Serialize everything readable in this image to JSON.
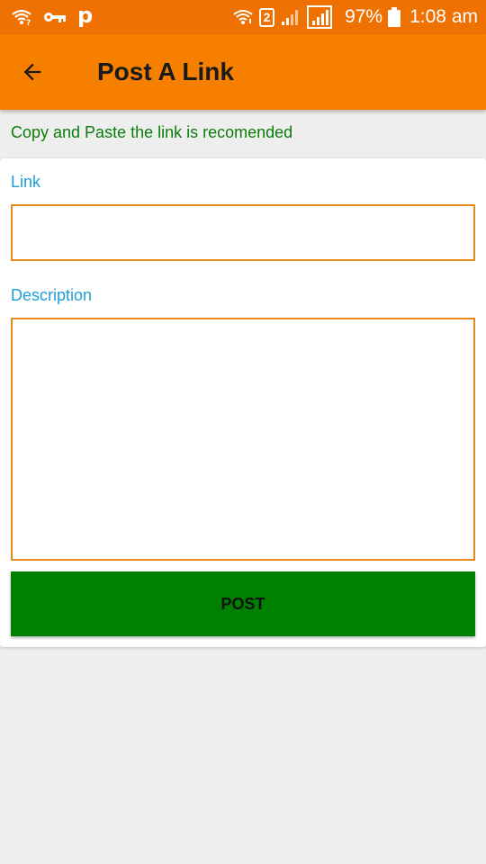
{
  "status_bar": {
    "left_icons": [
      "wifi-question-icon",
      "vpn-key-icon",
      "p-app-icon"
    ],
    "p_label": "p",
    "sim_number": "2",
    "battery_percent": "97%",
    "time": "1:08 am"
  },
  "app_bar": {
    "title": "Post A Link",
    "back_icon": "arrow-back-icon"
  },
  "hint": "Copy and Paste the link is recomended",
  "form": {
    "link_label": "Link",
    "link_value": "",
    "description_label": "Description",
    "description_value": "",
    "post_label": "POST"
  },
  "colors": {
    "status_bar": "#ee7102",
    "app_bar": "#f77f00",
    "hint_text": "#0a7d0a",
    "label_text": "#1e9fd8",
    "field_border": "#e8891f",
    "post_button": "#008000",
    "background": "#eeeeee"
  }
}
